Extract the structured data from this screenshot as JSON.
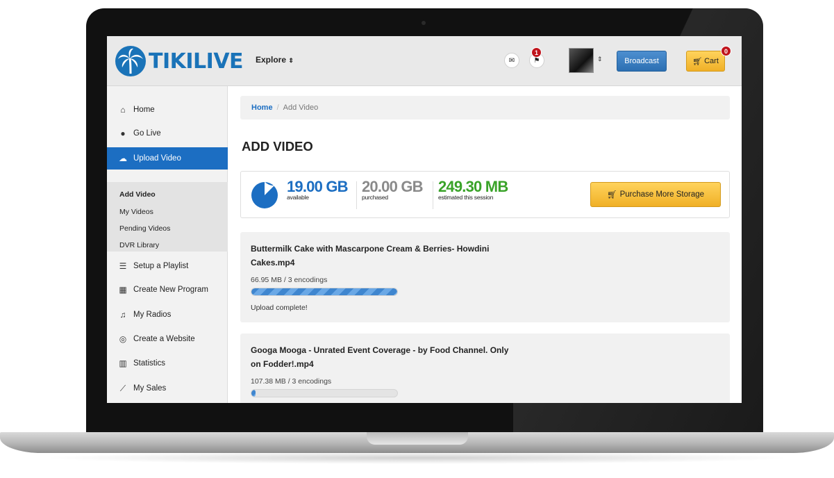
{
  "header": {
    "logo_text": "TIKILIVE",
    "explore_label": "Explore",
    "explore_caret": "⇕",
    "messages_icon": "envelope-icon",
    "notifications_icon": "flag-icon",
    "notifications_badge": "1",
    "avatar_caret": "⇕",
    "broadcast_label": "Broadcast",
    "cart_label": "Cart",
    "cart_badge": "0"
  },
  "sidebar": {
    "items": [
      {
        "icon": "home-icon",
        "glyph": "⌂",
        "label": "Home"
      },
      {
        "icon": "play-circle-icon",
        "glyph": "●",
        "label": "Go Live"
      },
      {
        "icon": "cloud-upload-icon",
        "glyph": "☁",
        "label": "Upload Video",
        "active": true
      },
      {
        "icon": "list-icon",
        "glyph": "☰",
        "label": "Setup a Playlist"
      },
      {
        "icon": "calendar-icon",
        "glyph": "▦",
        "label": "Create New Program"
      },
      {
        "icon": "music-icon",
        "glyph": "♫",
        "label": "My Radios"
      },
      {
        "icon": "wordpress-icon",
        "glyph": "◎",
        "label": "Create a Website"
      },
      {
        "icon": "bar-chart-icon",
        "glyph": "▥",
        "label": "Statistics"
      },
      {
        "icon": "line-chart-icon",
        "glyph": "⟋",
        "label": "My Sales"
      }
    ],
    "subitems": [
      {
        "label": "Add Video",
        "active": true
      },
      {
        "label": "My Videos"
      },
      {
        "label": "Pending Videos"
      },
      {
        "label": "DVR Library"
      }
    ]
  },
  "breadcrumb": {
    "home": "Home",
    "separator": "/",
    "current": "Add Video"
  },
  "page_title": "ADD VIDEO",
  "storage": {
    "available_value": "19.00 GB",
    "available_label": "available",
    "purchased_value": "20.00 GB",
    "purchased_label": "purchased",
    "session_value": "249.30 MB",
    "session_label": "estimated this session",
    "used_fraction": 0.05,
    "purchase_button": "Purchase More Storage",
    "colors": {
      "available": "#1c6ec2",
      "purchased": "#8a8a8a",
      "session": "#3aa329"
    }
  },
  "uploads": [
    {
      "title_line1": "Buttermilk Cake with Mascarpone Cream & Berries- Howdini",
      "title_line2": "Cakes.mp4",
      "size": "66.95 MB / 3 encodings",
      "progress": 1.0,
      "status": "Upload complete!"
    },
    {
      "title_line1": "Googa Mooga - Unrated Event Coverage - by Food Channel. Only",
      "title_line2": "on Fodder!.mp4",
      "size": "107.38 MB / 3 encodings",
      "progress": 0.02,
      "status": ""
    }
  ]
}
